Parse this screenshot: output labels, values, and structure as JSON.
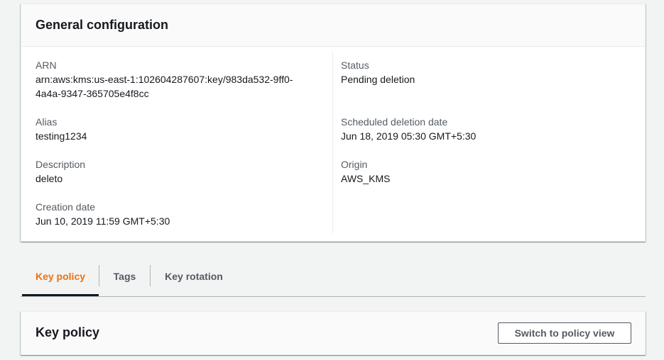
{
  "general": {
    "title": "General configuration",
    "left_fields": [
      {
        "label": "ARN",
        "value_line1": "arn:aws:kms:us-east-1:102604287607:key/983da532-9ff0-",
        "value_line2": "4a4a-9347-365705e4f8cc"
      },
      {
        "label": "Alias",
        "value": "testing1234"
      },
      {
        "label": "Description",
        "value": "deleto"
      },
      {
        "label": "Creation date",
        "value": "Jun 10, 2019 11:59 GMT+5:30"
      }
    ],
    "right_fields": [
      {
        "label": "Status",
        "value": "Pending deletion"
      },
      {
        "label": "Scheduled deletion date",
        "value": "Jun 18, 2019 05:30 GMT+5:30"
      },
      {
        "label": "Origin",
        "value": "AWS_KMS"
      }
    ]
  },
  "tabs": [
    {
      "label": "Key policy",
      "active": true
    },
    {
      "label": "Tags",
      "active": false
    },
    {
      "label": "Key rotation",
      "active": false
    }
  ],
  "key_policy": {
    "title": "Key policy",
    "switch_button_label": "Switch to policy view"
  },
  "colors": {
    "accent": "#ec7211",
    "text": "#16191f",
    "label": "#545b64",
    "background": "#f2f3f3"
  }
}
